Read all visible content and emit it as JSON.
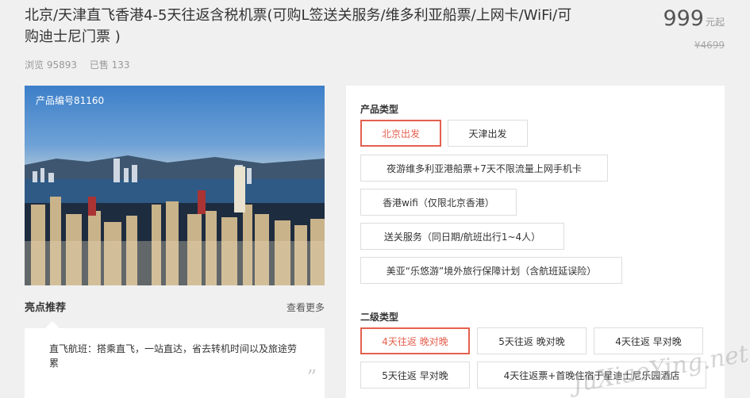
{
  "product": {
    "title": "北京/天津直飞香港4-5天往返含税机票(可购L签送关服务/维多利亚船票/上网卡/WiFi/可购迪士尼门票 )",
    "views": "浏览 95893",
    "sold": "已售 133",
    "price": "999",
    "price_unit": "元起",
    "original_price": "¥4699",
    "product_code": "产品编号81160"
  },
  "highlights": {
    "title": "亮点推荐",
    "more_label": "查看更多",
    "text": "直飞航班：搭乘直飞，一站直达，省去转机时间以及旅途劳累",
    "quote_mark": "”"
  },
  "options": {
    "product_type_label": "产品类型",
    "product_types": [
      {
        "label": "北京出发",
        "selected": true
      },
      {
        "label": "天津出发",
        "selected": false
      },
      {
        "label": "夜游维多利亚港船票+7天不限流量上网手机卡",
        "selected": false
      },
      {
        "label": "香港wifi（仅限北京香港）",
        "selected": false
      },
      {
        "label": "送关服务（同日期/航班出行1~4人）",
        "selected": false
      },
      {
        "label": "美亚“乐悠游”境外旅行保障计划（含航班延误险）",
        "selected": false
      }
    ],
    "sub_type_label": "二级类型",
    "sub_types": [
      {
        "label": "4天往返 晚对晚",
        "selected": true
      },
      {
        "label": "5天往返 晚对晚",
        "selected": false
      },
      {
        "label": "4天往返 早对晚",
        "selected": false
      },
      {
        "label": "5天往返 早对晚",
        "selected": false
      },
      {
        "label": "4天往返票+首晚住宿于星迪士尼乐园酒店",
        "selected": false
      }
    ]
  },
  "watermark": "JuXiaoYing.net",
  "colors": {
    "accent": "#e4604f",
    "price": "#555555",
    "muted": "#999999"
  }
}
